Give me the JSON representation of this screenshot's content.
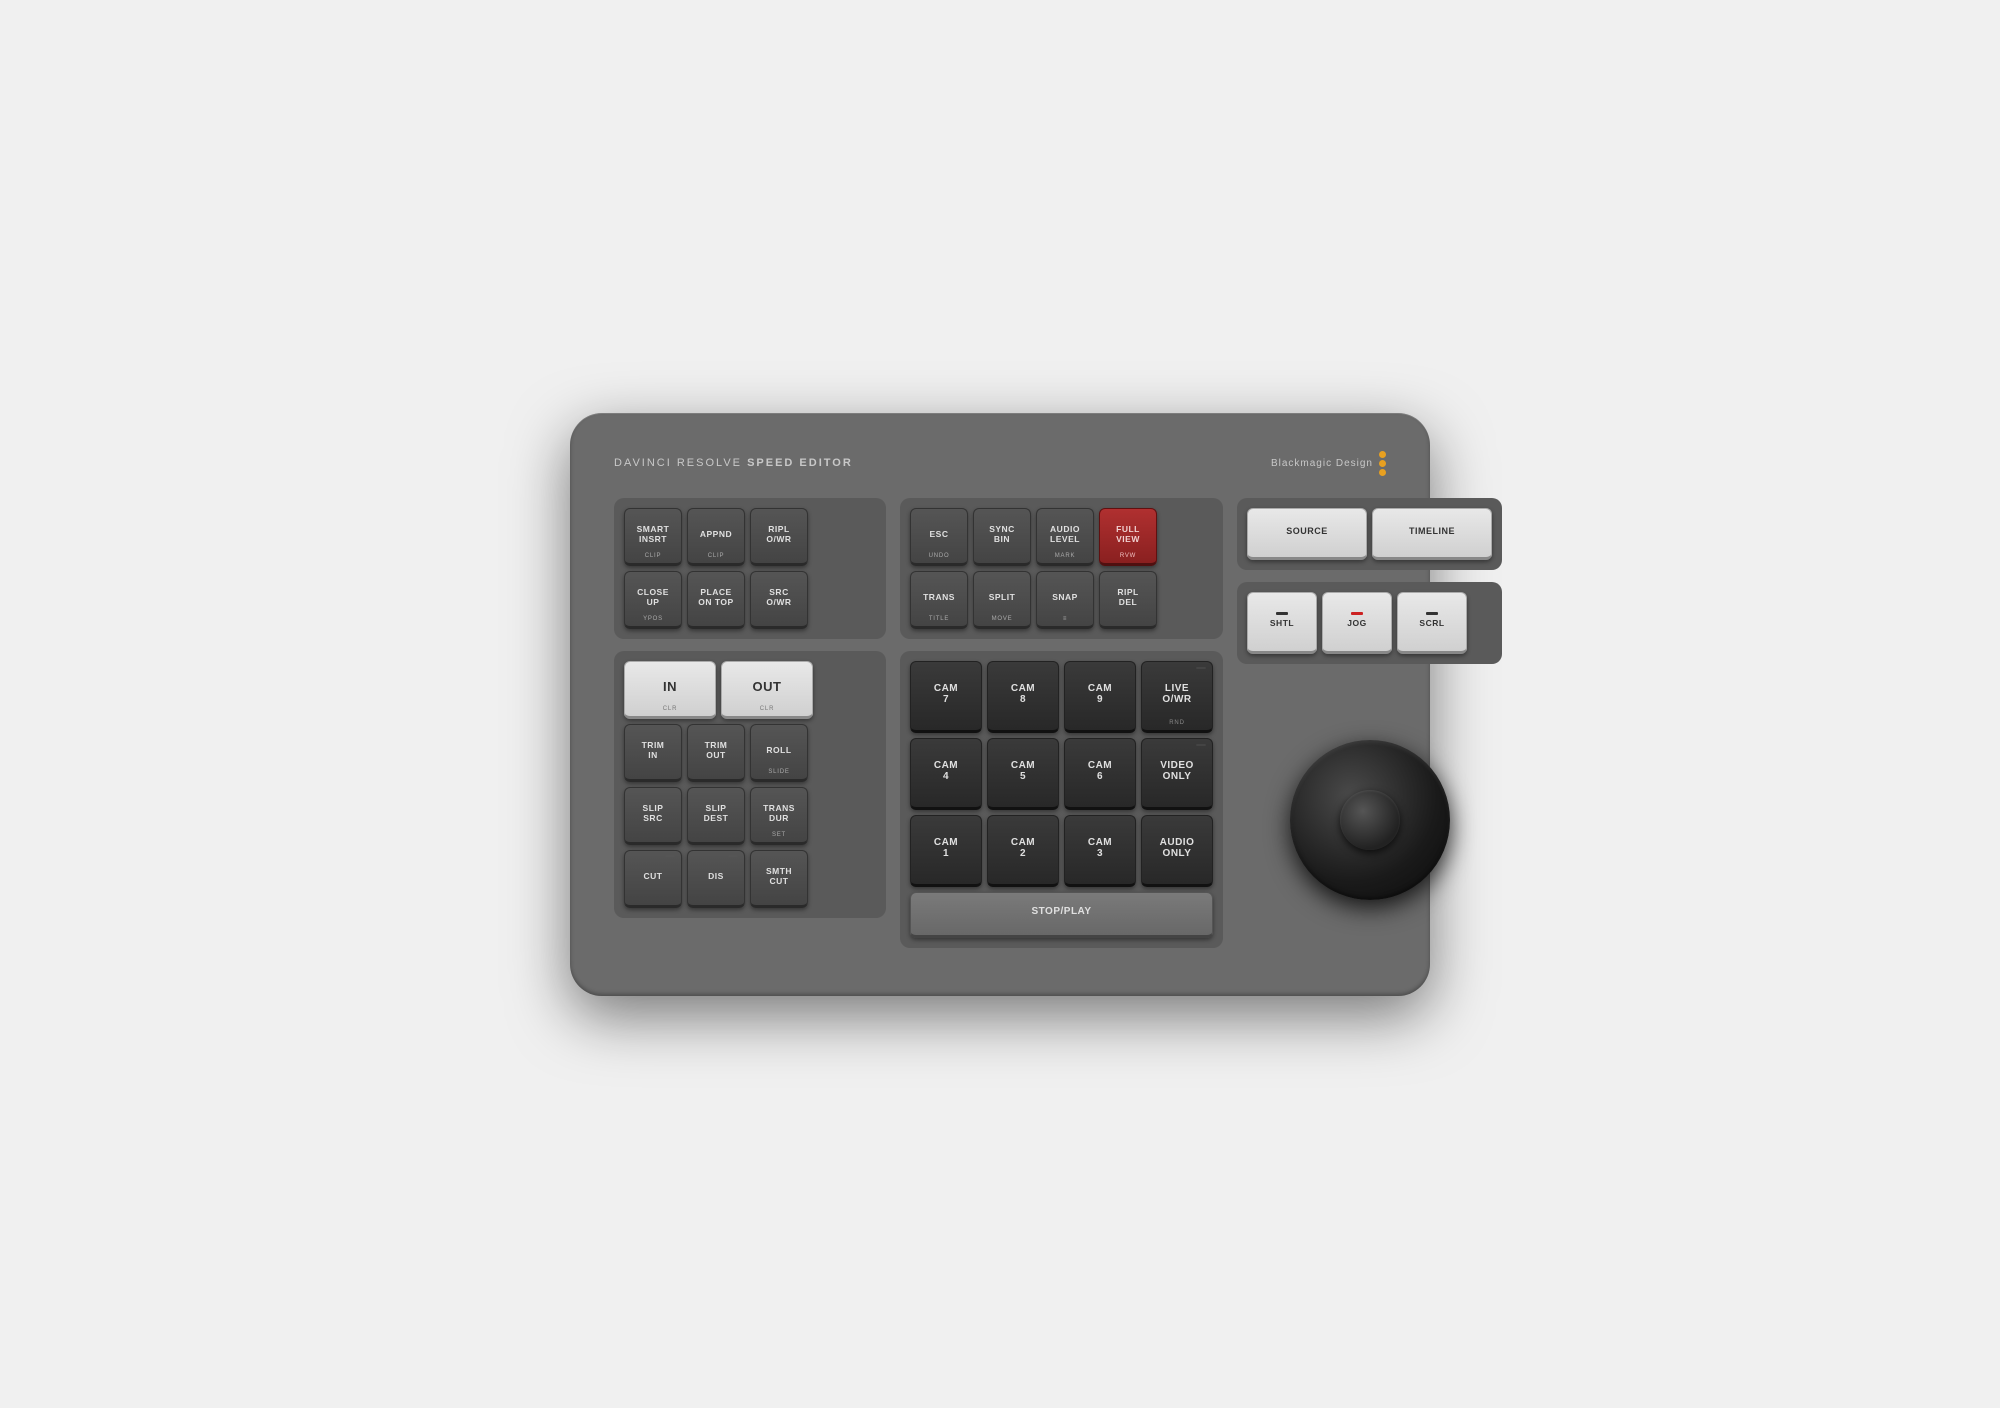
{
  "device": {
    "title_plain": "DAVINCI RESOLVE",
    "title_bold": "SPEED EDITOR",
    "brand": "Blackmagic Design"
  },
  "top_row": {
    "keys": [
      {
        "id": "smart-insrt",
        "label": "SMART\nINSRT",
        "sub": "CLIP",
        "type": "dark"
      },
      {
        "id": "appnd",
        "label": "APPND",
        "sub": "CLIP",
        "type": "dark"
      },
      {
        "id": "ripl-owr",
        "label": "RIPL\nO/WR",
        "sub": "",
        "type": "dark"
      }
    ]
  },
  "second_row": {
    "keys": [
      {
        "id": "close-up",
        "label": "CLOSE\nUP",
        "sub": "YPOS",
        "type": "dark"
      },
      {
        "id": "place-on-top",
        "label": "PLACE\nON TOP",
        "sub": "",
        "type": "dark"
      },
      {
        "id": "src-owr",
        "label": "SRC\nO/WR",
        "sub": "",
        "type": "dark"
      }
    ]
  },
  "in_out_row": {
    "keys": [
      {
        "id": "in",
        "label": "IN",
        "sub": "CLR",
        "type": "white"
      },
      {
        "id": "out",
        "label": "OUT",
        "sub": "CLR",
        "type": "white"
      }
    ]
  },
  "trim_row": {
    "keys": [
      {
        "id": "trim-in",
        "label": "TRIM\nIN",
        "sub": "",
        "type": "dark"
      },
      {
        "id": "trim-out",
        "label": "TRIM\nOUT",
        "sub": "",
        "type": "dark"
      },
      {
        "id": "roll",
        "label": "ROLL",
        "sub": "SLIDE",
        "type": "dark"
      }
    ]
  },
  "slip_row": {
    "keys": [
      {
        "id": "slip-src",
        "label": "SLIP\nSRC",
        "sub": "",
        "type": "dark"
      },
      {
        "id": "slip-dest",
        "label": "SLIP\nDEST",
        "sub": "",
        "type": "dark"
      },
      {
        "id": "trans-dur",
        "label": "TRANS\nDUR",
        "sub": "SET",
        "type": "dark"
      }
    ]
  },
  "cut_row": {
    "keys": [
      {
        "id": "cut",
        "label": "CUT",
        "sub": "",
        "type": "dark"
      },
      {
        "id": "dis",
        "label": "DIS",
        "sub": "",
        "type": "dark"
      },
      {
        "id": "smth-cut",
        "label": "SMTH\nCUT",
        "sub": "",
        "type": "dark"
      }
    ]
  },
  "function_keys": {
    "row1": [
      {
        "id": "esc",
        "label": "ESC",
        "sub": "UNDO",
        "type": "dark"
      },
      {
        "id": "sync-bin",
        "label": "SYNC\nBIN",
        "sub": "",
        "type": "dark"
      },
      {
        "id": "audio-level",
        "label": "AUDIO\nLEVEL",
        "sub": "MARK",
        "type": "dark"
      },
      {
        "id": "full-view",
        "label": "FULL\nVIEW",
        "sub": "RVW",
        "type": "red"
      }
    ],
    "row2": [
      {
        "id": "trans",
        "label": "TRANS",
        "sub": "TITLE",
        "type": "dark"
      },
      {
        "id": "split",
        "label": "SPLIT",
        "sub": "MOVE",
        "type": "dark"
      },
      {
        "id": "snap",
        "label": "SNAP",
        "sub": "≡",
        "type": "dark"
      },
      {
        "id": "ripl-del",
        "label": "RIPL\nDEL",
        "sub": "",
        "type": "dark"
      }
    ]
  },
  "cam_keys": {
    "row1": [
      {
        "id": "cam7",
        "label": "CAM\n7",
        "sub": "",
        "type": "cam"
      },
      {
        "id": "cam8",
        "label": "CAM\n8",
        "sub": "",
        "type": "cam"
      },
      {
        "id": "cam9",
        "label": "CAM\n9",
        "sub": "",
        "type": "cam"
      },
      {
        "id": "live-owr",
        "label": "LIVE\nO/WR",
        "sub": "RND",
        "type": "cam"
      }
    ],
    "row2": [
      {
        "id": "cam4",
        "label": "CAM\n4",
        "sub": "",
        "type": "cam"
      },
      {
        "id": "cam5",
        "label": "CAM\n5",
        "sub": "",
        "type": "cam"
      },
      {
        "id": "cam6",
        "label": "CAM\n6",
        "sub": "",
        "type": "cam"
      },
      {
        "id": "video-only",
        "label": "VIDEO\nONLY",
        "sub": "",
        "type": "cam"
      }
    ],
    "row3": [
      {
        "id": "cam1",
        "label": "CAM\n1",
        "sub": "",
        "type": "cam"
      },
      {
        "id": "cam2",
        "label": "CAM\n2",
        "sub": "",
        "type": "cam"
      },
      {
        "id": "cam3",
        "label": "CAM\n3",
        "sub": "",
        "type": "cam"
      },
      {
        "id": "audio-only",
        "label": "AUDIO\nONLY",
        "sub": "",
        "type": "cam"
      }
    ],
    "stop_play": "STOP/PLAY"
  },
  "right_keys": {
    "source": "SOURCE",
    "timeline": "TIMELINE",
    "shtl": "SHTL",
    "jog": "JOG",
    "scrl": "SCRL"
  }
}
